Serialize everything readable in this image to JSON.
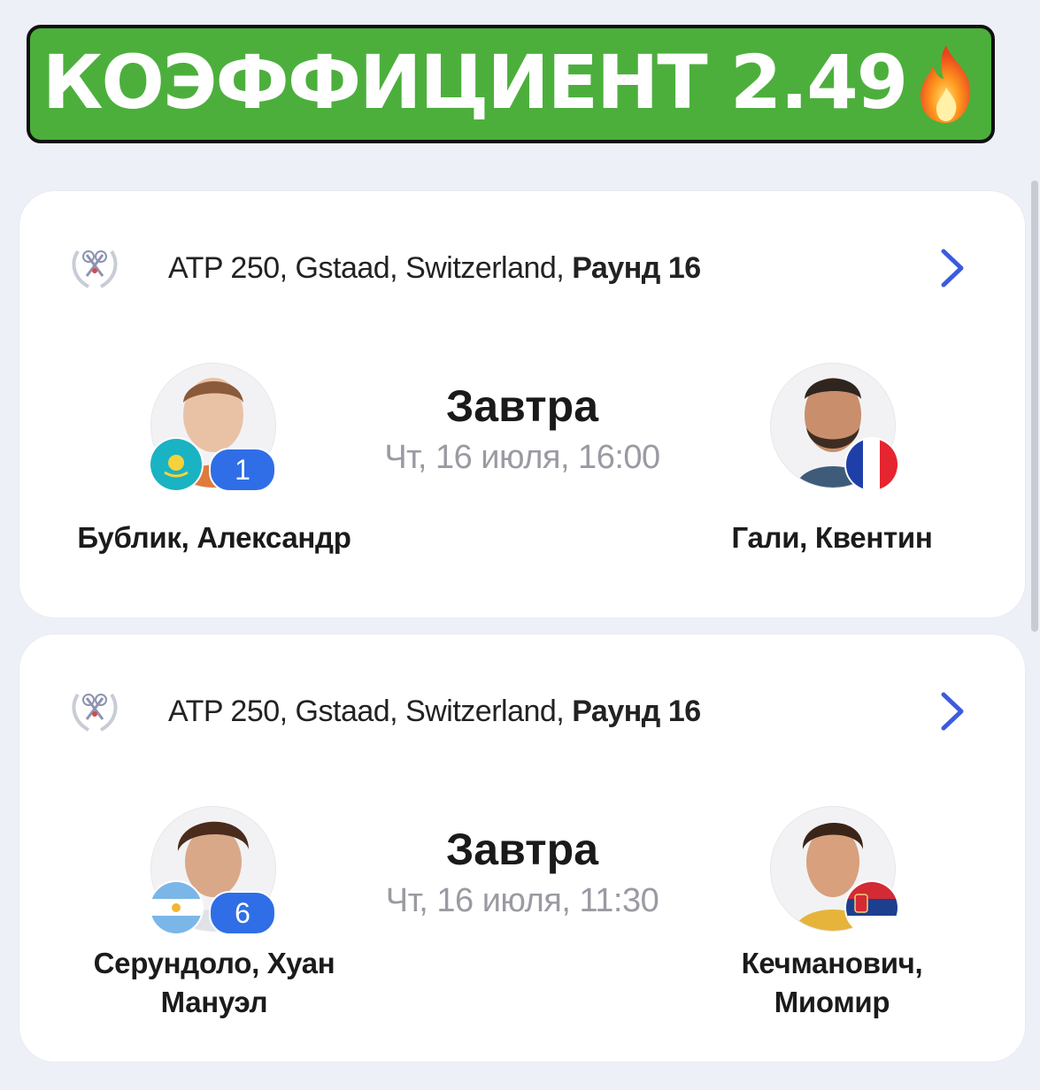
{
  "banner": {
    "text": "КОЭФФИЦИЕНТ 2.49",
    "icon": "fire-icon"
  },
  "matches": [
    {
      "tournament_prefix": "ATP 250, Gstaad, Switzerland, ",
      "round": "Раунд 16",
      "day": "Завтра",
      "datetime": "Чт, 16 июля,  16:00",
      "player1": {
        "name": "Бублик, Александр",
        "seed": "1",
        "flag": "kazakhstan-flag-icon"
      },
      "player2": {
        "name": "Гали, Квентин",
        "flag": "france-flag-icon"
      }
    },
    {
      "tournament_prefix": "ATP 250, Gstaad, Switzerland, ",
      "round": "Раунд 16",
      "day": "Завтра",
      "datetime": "Чт, 16 июля,  11:30",
      "player1": {
        "name_line1": "Серундоло, Хуан",
        "name_line2": "Мануэл",
        "seed": "6",
        "flag": "argentina-flag-icon"
      },
      "player2": {
        "name_line1": "Кечманович,",
        "name_line2": "Миомир",
        "flag": "serbia-flag-icon"
      }
    }
  ],
  "colors": {
    "banner_green": "#4caf3c",
    "seed_blue": "#2f6ee6",
    "chevron_blue": "#3b5be0"
  }
}
